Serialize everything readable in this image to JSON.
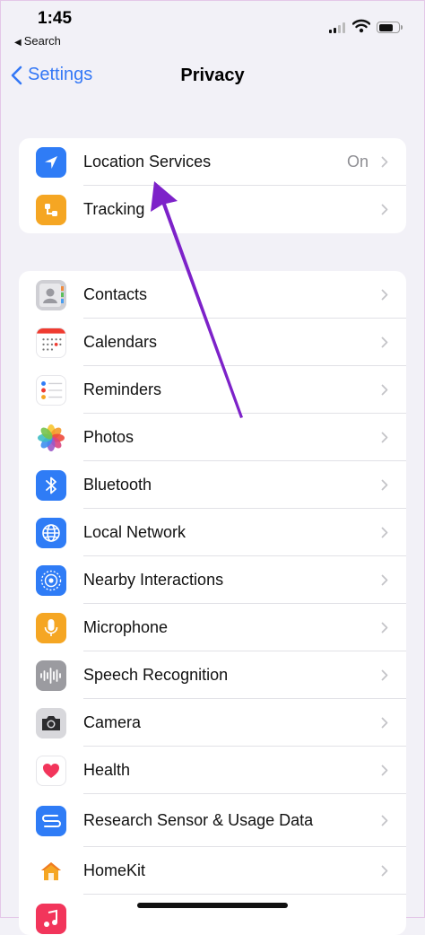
{
  "status_bar": {
    "time": "1:45",
    "back_app": "Search"
  },
  "nav": {
    "back_label": "Settings",
    "title": "Privacy"
  },
  "group1": [
    {
      "label": "Location Services",
      "value": "On",
      "icon": "location-arrow-icon",
      "color": "#2f7cf6"
    },
    {
      "label": "Tracking",
      "value": "",
      "icon": "tracking-icon",
      "color": "#f5a623"
    }
  ],
  "group2": [
    {
      "label": "Contacts",
      "icon": "contacts-icon",
      "color": "#cfcfd4"
    },
    {
      "label": "Calendars",
      "icon": "calendar-icon",
      "color": "#ffffff"
    },
    {
      "label": "Reminders",
      "icon": "reminders-icon",
      "color": "#ffffff"
    },
    {
      "label": "Photos",
      "icon": "photos-icon",
      "color": "#ffffff"
    },
    {
      "label": "Bluetooth",
      "icon": "bluetooth-icon",
      "color": "#2f7cf6"
    },
    {
      "label": "Local Network",
      "icon": "globe-icon",
      "color": "#2f7cf6"
    },
    {
      "label": "Nearby Interactions",
      "icon": "nearby-icon",
      "color": "#2f7cf6"
    },
    {
      "label": "Microphone",
      "icon": "microphone-icon",
      "color": "#f5a623"
    },
    {
      "label": "Speech Recognition",
      "icon": "waveform-icon",
      "color": "#9b9ba0"
    },
    {
      "label": "Camera",
      "icon": "camera-icon",
      "color": "#d8d8dc"
    },
    {
      "label": "Health",
      "icon": "heart-icon",
      "color": "#ffffff"
    },
    {
      "label": "Research Sensor & Usage Data",
      "icon": "research-icon",
      "color": "#2f7cf6"
    },
    {
      "label": "HomeKit",
      "icon": "home-icon",
      "color": "#ffffff"
    }
  ],
  "colors": {
    "accent": "#3478f6",
    "arrow": "#7d22c9"
  }
}
